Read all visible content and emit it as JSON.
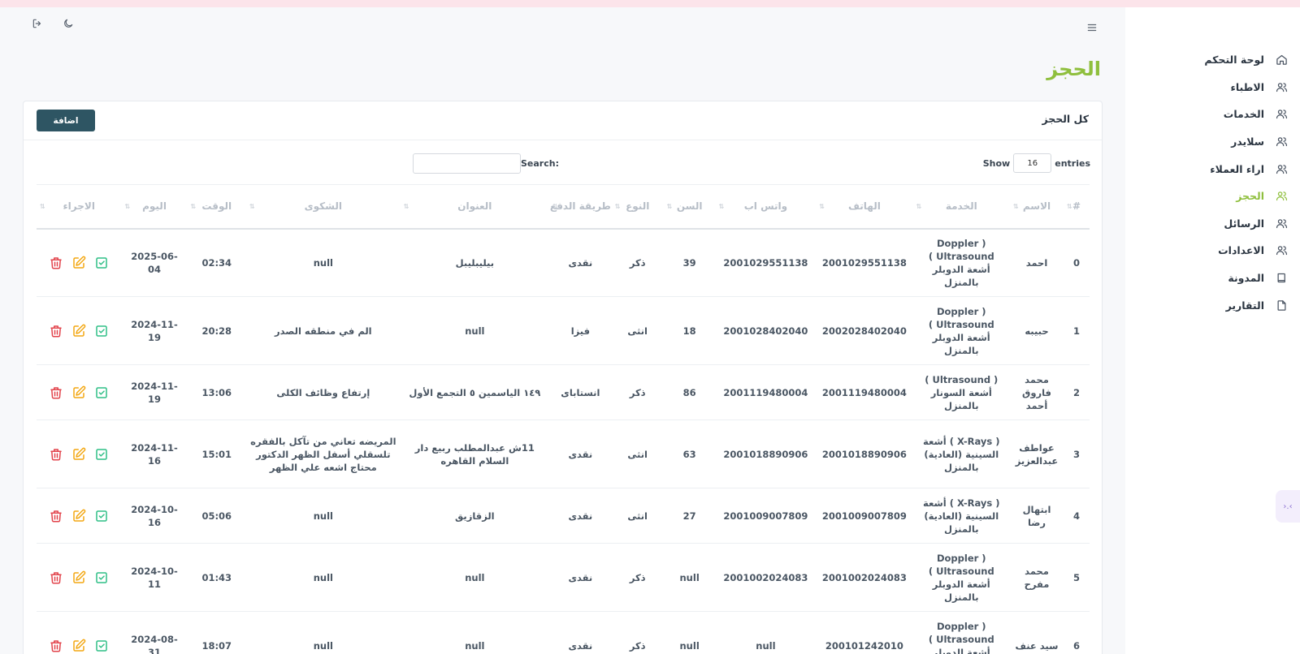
{
  "sidebar": {
    "items": [
      {
        "label": "لوحة التحكم",
        "icon": "home-icon"
      },
      {
        "label": "الاطباء",
        "icon": "users-icon"
      },
      {
        "label": "الخدمات",
        "icon": "users-icon"
      },
      {
        "label": "سلايدر",
        "icon": "users-icon"
      },
      {
        "label": "اراء العملاء",
        "icon": "users-icon"
      },
      {
        "label": "الحجز",
        "icon": "users-icon",
        "active": true
      },
      {
        "label": "الرسائل",
        "icon": "users-icon"
      },
      {
        "label": "الاعدادات",
        "icon": "users-icon"
      },
      {
        "label": "المدونة",
        "icon": "book-icon"
      },
      {
        "label": "التقارير",
        "icon": "file-icon"
      }
    ],
    "floating_tab": "›.‹"
  },
  "page": {
    "title": "الحجز",
    "accent": "#8fbf3d"
  },
  "card": {
    "title": "كل الحجز",
    "add_label": "اضافة"
  },
  "controls": {
    "show_label": "Show",
    "entries_value": "16",
    "entries_label": "entries",
    "search_label": "Search:",
    "search_value": ""
  },
  "table": {
    "headers": [
      "#",
      "الاسم",
      "الخدمة",
      "الهاتف",
      "واتس اب",
      "السن",
      "النوع",
      "طريقة الدفع",
      "العنوان",
      "الشكوى",
      "الوقت",
      "اليوم",
      "الاجراء"
    ],
    "rows": [
      {
        "num": "0",
        "name": "احمد",
        "service": "( Doppler Ultrasound ) أشعة الدوبلر بالمنزل",
        "phone": "2001029551138",
        "whatsapp": "2001029551138",
        "age": "39",
        "gender": "ذكر",
        "payment": "نقدى",
        "address": "بيليبليبل",
        "complaint": "null",
        "time": "02:34",
        "day": "2025-06-04"
      },
      {
        "num": "1",
        "name": "حبيبه",
        "service": "( Doppler Ultrasound ) أشعة الدوبلر بالمنزل",
        "phone": "2002028402040",
        "whatsapp": "2001028402040",
        "age": "18",
        "gender": "انثى",
        "payment": "فيزا",
        "address": "null",
        "complaint": "الم في منطقه الصدر",
        "time": "20:28",
        "day": "2024-11-19"
      },
      {
        "num": "2",
        "name": "محمد فاروق أحمد",
        "service": "( Ultrasound ) أشعة السونار بالمنزل",
        "phone": "2001119480004",
        "whatsapp": "2001119480004",
        "age": "86",
        "gender": "ذكر",
        "payment": "انستاباى",
        "address": "١٤٩ الياسمين ٥ التجمع الأول",
        "complaint": "إرتفاع وظائف الكلى",
        "time": "13:06",
        "day": "2024-11-19"
      },
      {
        "num": "3",
        "name": "عواطف عبدالعزيز",
        "service": "( X-Rays ) أشعة السينية (العادية) بالمنزل",
        "phone": "2001018890906",
        "whatsapp": "2001018890906",
        "age": "63",
        "gender": "انثى",
        "payment": "نقدى",
        "address": "11ش عبدالمطلب ربيع دار السلام القاهره",
        "complaint": "المريضه تعاني من تآكل بالفقره تلسقلي أسفل الظهر الدكتور محتاج اشعه علي الظهر",
        "time": "15:01",
        "day": "2024-11-16"
      },
      {
        "num": "4",
        "name": "ابتهال رضا",
        "service": "( X-Rays ) أشعة السينية (العادية) بالمنزل",
        "phone": "2001009007809",
        "whatsapp": "2001009007809",
        "age": "27",
        "gender": "انثى",
        "payment": "نقدى",
        "address": "الزقازيق",
        "complaint": "null",
        "time": "05:06",
        "day": "2024-10-16"
      },
      {
        "num": "5",
        "name": "محمد مفرح",
        "service": "( Doppler Ultrasound ) أشعة الدوبلر بالمنزل",
        "phone": "2001002024083",
        "whatsapp": "2001002024083",
        "age": "null",
        "gender": "ذكر",
        "payment": "نقدى",
        "address": "null",
        "complaint": "null",
        "time": "01:43",
        "day": "2024-10-11"
      },
      {
        "num": "6",
        "name": "سيد عنف",
        "service": "( Doppler Ultrasound ) أشعة الدوبلر بالمنزل",
        "phone": "200101242010",
        "whatsapp": "null",
        "age": "null",
        "gender": "ذكر",
        "payment": "نقدى",
        "address": "null",
        "complaint": "null",
        "time": "18:07",
        "day": "2024-08-31"
      }
    ]
  }
}
